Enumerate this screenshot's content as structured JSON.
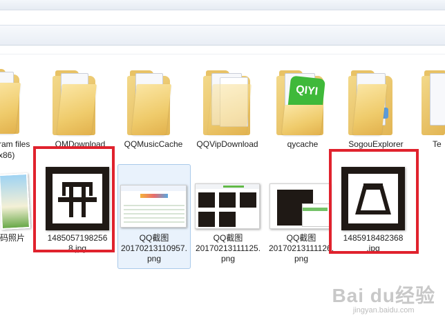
{
  "files": {
    "program_files_x86": {
      "line1": "ram files",
      "line2": "x86)"
    },
    "qmdownload": "QMDownload",
    "qqmusiccache": "QQMusicCache",
    "qqvipdownload": "QQVipDownload",
    "qycache": "qycache",
    "sogouexplorer": "SogouExplorer",
    "partial_right": "Te",
    "photos_partial": "码照片",
    "jpg_1485057": "1485057198256\n8.jpg",
    "qq_1": "QQ截图\n20170213110957.png",
    "qq_2": "QQ截图\n20170213111125.png",
    "qq_3": "QQ截图\n20170213111126.png",
    "jpg_1485918": "1485918482368\n.jpg"
  },
  "qiyi_logo": "QIYI",
  "watermark": {
    "main": "Bai du经验",
    "sub": "jingyan.baidu.com"
  },
  "colors": {
    "highlight_red": "#e0222d",
    "selection_blue": "#e9f2fc"
  }
}
